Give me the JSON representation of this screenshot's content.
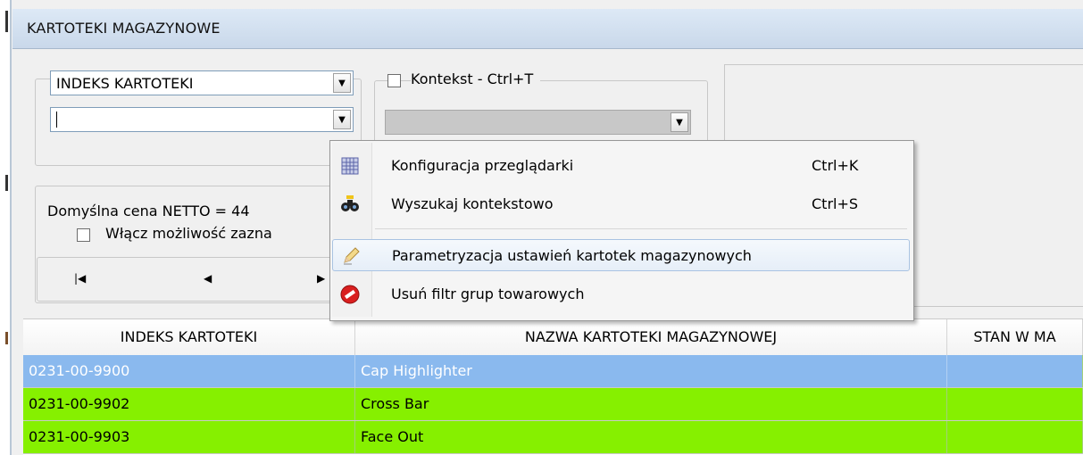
{
  "window": {
    "title": "KARTOTEKI MAGAZYNOWE"
  },
  "search": {
    "field_select": "INDEKS KARTOTEKI",
    "search_value": "",
    "context_label": "Kontekst - Ctrl+T",
    "context_value": ""
  },
  "info": {
    "default_price": "Domyślna cena NETTO = 44",
    "enable_selection": "Włącz możliwość zazna"
  },
  "nav": {
    "first": "first-record",
    "prev": "previous-record",
    "next": "next-record"
  },
  "context_menu": {
    "items": [
      {
        "label": "Konfiguracja przeglądarki",
        "shortcut": "Ctrl+K",
        "icon": "grid-config-icon"
      },
      {
        "label": "Wyszukaj kontekstowo",
        "shortcut": "Ctrl+S",
        "icon": "binoculars-search-icon"
      },
      {
        "label": "Parametryzacja ustawień kartotek  magazynowych",
        "shortcut": "",
        "icon": "pencil-icon"
      },
      {
        "label": "Usuń filtr grup towarowych",
        "shortcut": "",
        "icon": "remove-filter-icon"
      }
    ]
  },
  "grid": {
    "columns": [
      "INDEKS KARTOTEKI",
      "NAZWA KARTOTEKI MAGAZYNOWEJ",
      "STAN W MA"
    ],
    "rows": [
      {
        "index": "0231-00-9900",
        "name": "Cap Highlighter",
        "stock": "",
        "state": "selected"
      },
      {
        "index": "0231-00-9902",
        "name": "Cross Bar",
        "stock": "",
        "state": "green"
      },
      {
        "index": "0231-00-9903",
        "name": "Face Out",
        "stock": "",
        "state": "green"
      }
    ]
  },
  "colors": {
    "selected_row": "#8ab9ee",
    "green_row": "#86f000",
    "menu_highlight": "#e6eef8",
    "titlebar": "#d6e3f2"
  }
}
